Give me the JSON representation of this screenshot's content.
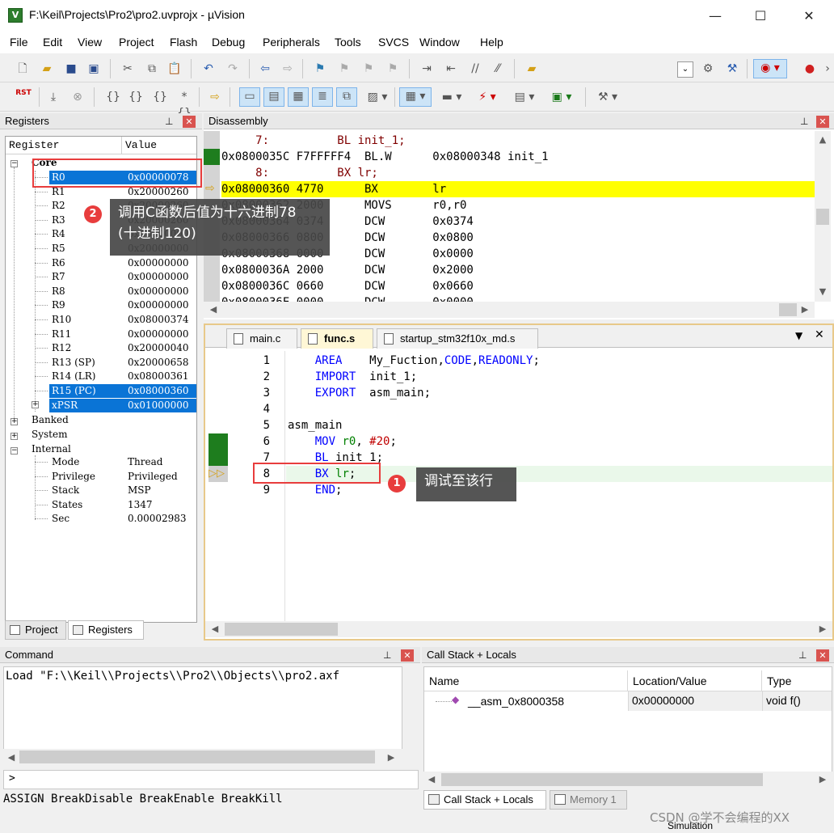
{
  "window": {
    "title": "F:\\Keil\\Projects\\Pro2\\pro2.uvprojx - µVision",
    "app_icon": "V",
    "minimize": "—",
    "maximize": "☐",
    "close": "✕"
  },
  "menu": [
    "File",
    "Edit",
    "View",
    "Project",
    "Flash",
    "Debug",
    "Peripherals",
    "Tools",
    "SVCS",
    "Window",
    "Help"
  ],
  "toolbar": {
    "rst_label": "RST"
  },
  "registers": {
    "title": "Registers",
    "col_register": "Register",
    "col_value": "Value",
    "core_label": "Core",
    "rows": [
      {
        "name": "R0",
        "value": "0x00000078"
      },
      {
        "name": "R1",
        "value": "0x20000260"
      },
      {
        "name": "R2",
        "value": "0x20000260"
      },
      {
        "name": "R3",
        "value": "0x20000260"
      },
      {
        "name": "R4",
        "value": "0x00000000"
      },
      {
        "name": "R5",
        "value": "0x20000000"
      },
      {
        "name": "R6",
        "value": "0x00000000"
      },
      {
        "name": "R7",
        "value": "0x00000000"
      },
      {
        "name": "R8",
        "value": "0x00000000"
      },
      {
        "name": "R9",
        "value": "0x00000000"
      },
      {
        "name": "R10",
        "value": "0x08000374"
      },
      {
        "name": "R11",
        "value": "0x00000000"
      },
      {
        "name": "R12",
        "value": "0x20000040"
      },
      {
        "name": "R13 (SP)",
        "value": "0x20000658"
      },
      {
        "name": "R14 (LR)",
        "value": "0x08000361"
      },
      {
        "name": "R15 (PC)",
        "value": "0x08000360"
      },
      {
        "name": "xPSR",
        "value": "0x01000000"
      }
    ],
    "groups": [
      "Banked",
      "System",
      "Internal"
    ],
    "internal": [
      {
        "name": "Mode",
        "value": "Thread"
      },
      {
        "name": "Privilege",
        "value": "Privileged"
      },
      {
        "name": "Stack",
        "value": "MSP"
      },
      {
        "name": "States",
        "value": "1347"
      },
      {
        "name": "Sec",
        "value": "0.00002983"
      }
    ],
    "tab_project": "Project",
    "tab_registers": "Registers"
  },
  "disassembly": {
    "title": "Disassembly",
    "lines": [
      {
        "text": "     7:          BL init_1;",
        "type": "src"
      },
      {
        "text": "0x0800035C F7FFFFF4  BL.W      0x08000348 init_1",
        "type": "asm"
      },
      {
        "text": "     8:          BX lr;",
        "type": "src"
      },
      {
        "text": "0x08000360 4770      BX        lr",
        "type": "cur"
      },
      {
        "text": "0x08000362 2000      MOVS      r0,r0",
        "type": "asm"
      },
      {
        "text": "0x08000364 0374      DCW       0x0374",
        "type": "asm"
      },
      {
        "text": "0x08000366 0800      DCW       0x0800",
        "type": "asm"
      },
      {
        "text": "0x08000368 0000      DCW       0x0000",
        "type": "asm"
      },
      {
        "text": "0x0800036A 2000      DCW       0x2000",
        "type": "asm"
      },
      {
        "text": "0x0800036C 0660      DCW       0x0660",
        "type": "asm"
      },
      {
        "text": "0x0800036E 0000      DCW       0x0000",
        "type": "asm"
      }
    ]
  },
  "editor": {
    "tabs": [
      "main.c",
      "func.s",
      "startup_stm32f10x_md.s"
    ],
    "active_tab": "func.s",
    "lines": [
      {
        "n": "1",
        "parts": [
          [
            "kw",
            "    AREA"
          ],
          [
            "t",
            "    My_Fuction,"
          ],
          [
            "kw",
            "CODE"
          ],
          [
            "t",
            ","
          ],
          [
            "kw",
            "READONLY"
          ],
          [
            "t",
            ";"
          ]
        ]
      },
      {
        "n": "2",
        "parts": [
          [
            "kw",
            "    IMPORT"
          ],
          [
            "t",
            "  init_1;"
          ]
        ]
      },
      {
        "n": "3",
        "parts": [
          [
            "kw",
            "    EXPORT"
          ],
          [
            "t",
            "  asm_main;"
          ]
        ]
      },
      {
        "n": "4",
        "parts": []
      },
      {
        "n": "5",
        "parts": [
          [
            "t",
            "asm_main"
          ]
        ]
      },
      {
        "n": "6",
        "parts": [
          [
            "kw",
            "    MOV"
          ],
          [
            "t",
            " "
          ],
          [
            "reg",
            "r0"
          ],
          [
            "t",
            ", "
          ],
          [
            "num",
            "#20"
          ],
          [
            "t",
            ";"
          ]
        ]
      },
      {
        "n": "7",
        "parts": [
          [
            "kw",
            "    BL"
          ],
          [
            "t",
            " init_1;"
          ]
        ]
      },
      {
        "n": "8",
        "parts": [
          [
            "kw",
            "    BX"
          ],
          [
            "t",
            " "
          ],
          [
            "reg",
            "lr"
          ],
          [
            "t",
            ";"
          ]
        ]
      },
      {
        "n": "9",
        "parts": [
          [
            "kw",
            "    END"
          ],
          [
            "t",
            ";"
          ]
        ]
      }
    ]
  },
  "annotations": {
    "callout1": "调试至该行",
    "callout2_line1": "调用C函数后值为十六进制78",
    "callout2_line2": "(十进制120)",
    "badge1": "1",
    "badge2": "2"
  },
  "command": {
    "title": "Command",
    "output": "Load \"F:\\\\Keil\\\\Projects\\\\Pro2\\\\Objects\\\\pro2.axf",
    "prompt": ">",
    "hint": "ASSIGN BreakDisable BreakEnable BreakKill"
  },
  "callstack": {
    "title": "Call Stack + Locals",
    "cols": [
      "Name",
      "Location/Value",
      "Type"
    ],
    "rows": [
      {
        "name": "__asm_0x8000358",
        "value": "0x00000000",
        "type": "void f()"
      }
    ],
    "tab_callstack": "Call Stack + Locals",
    "tab_memory": "Memory 1",
    "watermark": "CSDN @学不会编程的XX",
    "status": "Simulation"
  }
}
